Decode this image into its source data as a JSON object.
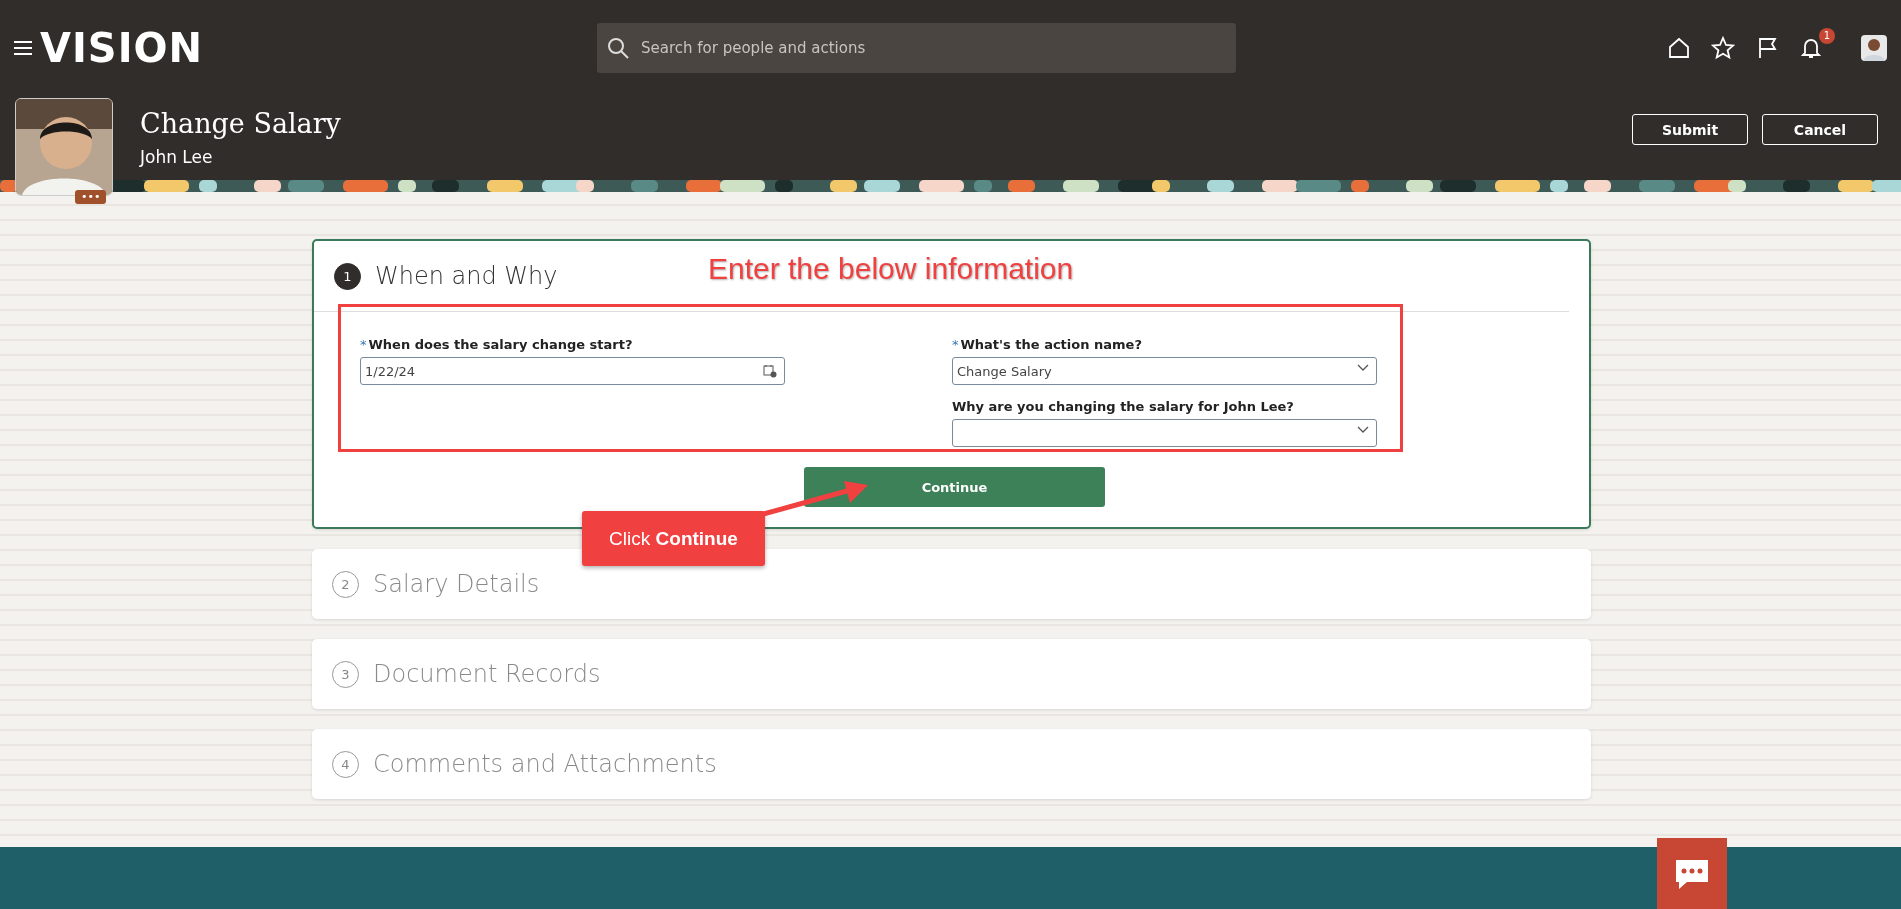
{
  "top_bar": {
    "logo": "VISION",
    "search": {
      "placeholder": "Search for people and actions"
    },
    "notification_count": "1"
  },
  "header": {
    "title": "Change Salary",
    "person": "John Lee",
    "more": "•••",
    "buttons": [
      {
        "label": "Submit"
      },
      {
        "label": "Cancel"
      }
    ]
  },
  "steps": [
    {
      "number": "1",
      "title": "When and Why",
      "expanded": true
    },
    {
      "number": "2",
      "title": "Salary Details",
      "expanded": false
    },
    {
      "number": "3",
      "title": "Document Records",
      "expanded": false
    },
    {
      "number": "4",
      "title": "Comments and Attachments",
      "expanded": false
    }
  ],
  "form": {
    "required_mark": "*",
    "fields": [
      {
        "label": "When does the salary change start?",
        "required": true,
        "kind": "date",
        "value": "1/22/24"
      },
      {
        "label": "What's the action name?",
        "required": true,
        "kind": "select",
        "value": "Change Salary"
      },
      {
        "label": "Why are you changing the salary for John Lee?",
        "required": false,
        "kind": "select"
      }
    ],
    "continue_button": "Continue"
  },
  "annotations": [
    {
      "kind": "heading",
      "text": "Enter the below information"
    },
    {
      "kind": "callout",
      "text": "Click **Continue**"
    }
  ]
}
